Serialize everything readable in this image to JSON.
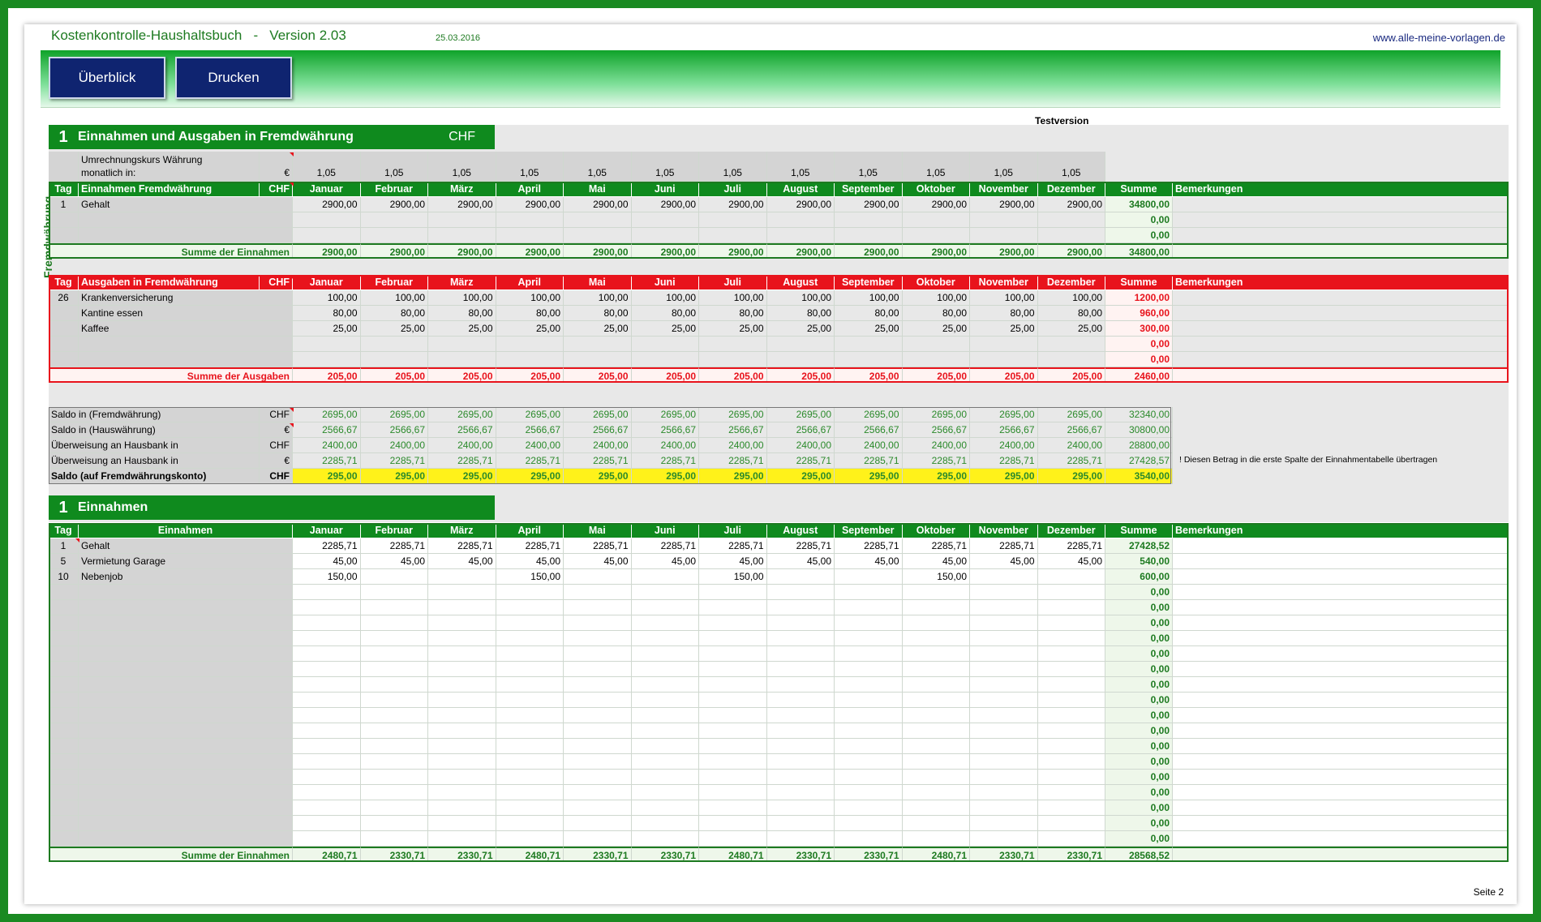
{
  "header": {
    "title": "Kostenkontrolle-Haushaltsbuch   -   Version 2.03",
    "date": "25.03.2016",
    "url": "www.alle-meine-vorlagen.de",
    "testversion": "Testversion",
    "page_label": "Seite 2",
    "side_label": "Fremdwährung"
  },
  "toolbar": {
    "overview_label": "Überblick",
    "print_label": "Drucken"
  },
  "months": [
    "Januar",
    "Februar",
    "März",
    "April",
    "Mai",
    "Juni",
    "Juli",
    "August",
    "September",
    "Oktober",
    "November",
    "Dezember"
  ],
  "colors": {
    "green": "#0f8a1e",
    "red": "#e8131c",
    "navy": "#0f2470",
    "yellow": "#fff21a"
  },
  "fx": {
    "section_num": "1",
    "section_title": "Einnahmen und Ausgaben in Fremdwährung",
    "currency": "CHF",
    "rate_label_1": "Umrechnungskurs Währung",
    "rate_label_2": "monatlich in:",
    "rate_unit": "€",
    "rates": [
      "1,05",
      "1,05",
      "1,05",
      "1,05",
      "1,05",
      "1,05",
      "1,05",
      "1,05",
      "1,05",
      "1,05",
      "1,05",
      "1,05"
    ],
    "income": {
      "hdr_tag": "Tag",
      "hdr_label": "Einnahmen Fremdwährung",
      "hdr_cur": "CHF",
      "hdr_sum": "Summe",
      "hdr_notes": "Bemerkungen",
      "rows": [
        {
          "tag": "1",
          "name": "Gehalt",
          "values": [
            "2900,00",
            "2900,00",
            "2900,00",
            "2900,00",
            "2900,00",
            "2900,00",
            "2900,00",
            "2900,00",
            "2900,00",
            "2900,00",
            "2900,00",
            "2900,00"
          ],
          "sum": "34800,00"
        },
        {
          "tag": "",
          "name": "",
          "values": [
            "",
            "",
            "",
            "",
            "",
            "",
            "",
            "",
            "",
            "",
            "",
            ""
          ],
          "sum": "0,00"
        },
        {
          "tag": "",
          "name": "",
          "values": [
            "",
            "",
            "",
            "",
            "",
            "",
            "",
            "",
            "",
            "",
            "",
            ""
          ],
          "sum": "0,00"
        }
      ],
      "total_label": "Summe der Einnahmen",
      "totals": [
        "2900,00",
        "2900,00",
        "2900,00",
        "2900,00",
        "2900,00",
        "2900,00",
        "2900,00",
        "2900,00",
        "2900,00",
        "2900,00",
        "2900,00",
        "2900,00"
      ],
      "total_sum": "34800,00"
    },
    "expenses": {
      "hdr_tag": "Tag",
      "hdr_label": "Ausgaben in Fremdwährung",
      "hdr_cur": "CHF",
      "hdr_sum": "Summe",
      "hdr_notes": "Bemerkungen",
      "rows": [
        {
          "tag": "26",
          "name": "Krankenversicherung",
          "values": [
            "100,00",
            "100,00",
            "100,00",
            "100,00",
            "100,00",
            "100,00",
            "100,00",
            "100,00",
            "100,00",
            "100,00",
            "100,00",
            "100,00"
          ],
          "sum": "1200,00"
        },
        {
          "tag": "",
          "name": "Kantine essen",
          "values": [
            "80,00",
            "80,00",
            "80,00",
            "80,00",
            "80,00",
            "80,00",
            "80,00",
            "80,00",
            "80,00",
            "80,00",
            "80,00",
            "80,00"
          ],
          "sum": "960,00"
        },
        {
          "tag": "",
          "name": "Kaffee",
          "values": [
            "25,00",
            "25,00",
            "25,00",
            "25,00",
            "25,00",
            "25,00",
            "25,00",
            "25,00",
            "25,00",
            "25,00",
            "25,00",
            "25,00"
          ],
          "sum": "300,00"
        },
        {
          "tag": "",
          "name": "",
          "values": [
            "",
            "",
            "",
            "",
            "",
            "",
            "",
            "",
            "",
            "",
            "",
            ""
          ],
          "sum": "0,00"
        },
        {
          "tag": "",
          "name": "",
          "values": [
            "",
            "",
            "",
            "",
            "",
            "",
            "",
            "",
            "",
            "",
            "",
            ""
          ],
          "sum": "0,00"
        }
      ],
      "total_label": "Summe der Ausgaben",
      "totals": [
        "205,00",
        "205,00",
        "205,00",
        "205,00",
        "205,00",
        "205,00",
        "205,00",
        "205,00",
        "205,00",
        "205,00",
        "205,00",
        "205,00"
      ],
      "total_sum": "2460,00"
    },
    "saldo": [
      {
        "label": "Saldo in (Fremdwährung)",
        "unit": "CHF",
        "values": [
          "2695,00",
          "2695,00",
          "2695,00",
          "2695,00",
          "2695,00",
          "2695,00",
          "2695,00",
          "2695,00",
          "2695,00",
          "2695,00",
          "2695,00",
          "2695,00"
        ],
        "sum": "32340,00"
      },
      {
        "label": "Saldo in (Hauswährung)",
        "unit": "€",
        "values": [
          "2566,67",
          "2566,67",
          "2566,67",
          "2566,67",
          "2566,67",
          "2566,67",
          "2566,67",
          "2566,67",
          "2566,67",
          "2566,67",
          "2566,67",
          "2566,67"
        ],
        "sum": "30800,00"
      },
      {
        "label": "Überweisung an Hausbank in",
        "unit": "CHF",
        "values": [
          "2400,00",
          "2400,00",
          "2400,00",
          "2400,00",
          "2400,00",
          "2400,00",
          "2400,00",
          "2400,00",
          "2400,00",
          "2400,00",
          "2400,00",
          "2400,00"
        ],
        "sum": "28800,00"
      },
      {
        "label": "Überweisung an Hausbank in",
        "unit": "€",
        "values": [
          "2285,71",
          "2285,71",
          "2285,71",
          "2285,71",
          "2285,71",
          "2285,71",
          "2285,71",
          "2285,71",
          "2285,71",
          "2285,71",
          "2285,71",
          "2285,71"
        ],
        "sum": "27428,57"
      },
      {
        "label": "Saldo (auf Fremdwährungskonto)",
        "unit": "CHF",
        "values": [
          "295,00",
          "295,00",
          "295,00",
          "295,00",
          "295,00",
          "295,00",
          "295,00",
          "295,00",
          "295,00",
          "295,00",
          "295,00",
          "295,00"
        ],
        "sum": "3540,00"
      }
    ],
    "saldo_note": "! Diesen Betrag in die erste Spalte der Einnahmentabelle übertragen"
  },
  "income": {
    "section_num": "1",
    "section_title": "Einnahmen",
    "hdr_tag": "Tag",
    "hdr_label": "Einnahmen",
    "hdr_sum": "Summe",
    "hdr_notes": "Bemerkungen",
    "rows": [
      {
        "tag": "1",
        "name": "Gehalt",
        "values": [
          "2285,71",
          "2285,71",
          "2285,71",
          "2285,71",
          "2285,71",
          "2285,71",
          "2285,71",
          "2285,71",
          "2285,71",
          "2285,71",
          "2285,71",
          "2285,71"
        ],
        "sum": "27428,52"
      },
      {
        "tag": "5",
        "name": "Vermietung Garage",
        "values": [
          "45,00",
          "45,00",
          "45,00",
          "45,00",
          "45,00",
          "45,00",
          "45,00",
          "45,00",
          "45,00",
          "45,00",
          "45,00",
          "45,00"
        ],
        "sum": "540,00"
      },
      {
        "tag": "10",
        "name": "Nebenjob",
        "values": [
          "150,00",
          "",
          "",
          "150,00",
          "",
          "",
          "150,00",
          "",
          "",
          "150,00",
          "",
          ""
        ],
        "sum": "600,00"
      },
      {
        "tag": "",
        "name": "",
        "values": [
          "",
          "",
          "",
          "",
          "",
          "",
          "",
          "",
          "",
          "",
          "",
          ""
        ],
        "sum": "0,00"
      },
      {
        "tag": "",
        "name": "",
        "values": [
          "",
          "",
          "",
          "",
          "",
          "",
          "",
          "",
          "",
          "",
          "",
          ""
        ],
        "sum": "0,00"
      },
      {
        "tag": "",
        "name": "",
        "values": [
          "",
          "",
          "",
          "",
          "",
          "",
          "",
          "",
          "",
          "",
          "",
          ""
        ],
        "sum": "0,00"
      },
      {
        "tag": "",
        "name": "",
        "values": [
          "",
          "",
          "",
          "",
          "",
          "",
          "",
          "",
          "",
          "",
          "",
          ""
        ],
        "sum": "0,00"
      },
      {
        "tag": "",
        "name": "",
        "values": [
          "",
          "",
          "",
          "",
          "",
          "",
          "",
          "",
          "",
          "",
          "",
          ""
        ],
        "sum": "0,00"
      },
      {
        "tag": "",
        "name": "",
        "values": [
          "",
          "",
          "",
          "",
          "",
          "",
          "",
          "",
          "",
          "",
          "",
          ""
        ],
        "sum": "0,00"
      },
      {
        "tag": "",
        "name": "",
        "values": [
          "",
          "",
          "",
          "",
          "",
          "",
          "",
          "",
          "",
          "",
          "",
          ""
        ],
        "sum": "0,00"
      },
      {
        "tag": "",
        "name": "",
        "values": [
          "",
          "",
          "",
          "",
          "",
          "",
          "",
          "",
          "",
          "",
          "",
          ""
        ],
        "sum": "0,00"
      },
      {
        "tag": "",
        "name": "",
        "values": [
          "",
          "",
          "",
          "",
          "",
          "",
          "",
          "",
          "",
          "",
          "",
          ""
        ],
        "sum": "0,00"
      },
      {
        "tag": "",
        "name": "",
        "values": [
          "",
          "",
          "",
          "",
          "",
          "",
          "",
          "",
          "",
          "",
          "",
          ""
        ],
        "sum": "0,00"
      },
      {
        "tag": "",
        "name": "",
        "values": [
          "",
          "",
          "",
          "",
          "",
          "",
          "",
          "",
          "",
          "",
          "",
          ""
        ],
        "sum": "0,00"
      },
      {
        "tag": "",
        "name": "",
        "values": [
          "",
          "",
          "",
          "",
          "",
          "",
          "",
          "",
          "",
          "",
          "",
          ""
        ],
        "sum": "0,00"
      },
      {
        "tag": "",
        "name": "",
        "values": [
          "",
          "",
          "",
          "",
          "",
          "",
          "",
          "",
          "",
          "",
          "",
          ""
        ],
        "sum": "0,00"
      },
      {
        "tag": "",
        "name": "",
        "values": [
          "",
          "",
          "",
          "",
          "",
          "",
          "",
          "",
          "",
          "",
          "",
          ""
        ],
        "sum": "0,00"
      },
      {
        "tag": "",
        "name": "",
        "values": [
          "",
          "",
          "",
          "",
          "",
          "",
          "",
          "",
          "",
          "",
          "",
          ""
        ],
        "sum": "0,00"
      },
      {
        "tag": "",
        "name": "",
        "values": [
          "",
          "",
          "",
          "",
          "",
          "",
          "",
          "",
          "",
          "",
          "",
          ""
        ],
        "sum": "0,00"
      },
      {
        "tag": "",
        "name": "",
        "values": [
          "",
          "",
          "",
          "",
          "",
          "",
          "",
          "",
          "",
          "",
          "",
          ""
        ],
        "sum": "0,00"
      }
    ],
    "total_label": "Summe der Einnahmen",
    "totals": [
      "2480,71",
      "2330,71",
      "2330,71",
      "2480,71",
      "2330,71",
      "2330,71",
      "2480,71",
      "2330,71",
      "2330,71",
      "2480,71",
      "2330,71",
      "2330,71"
    ],
    "total_sum": "28568,52"
  }
}
